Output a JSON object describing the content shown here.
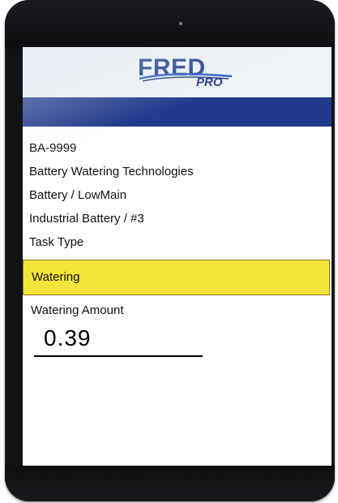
{
  "app": {
    "logo_main": "FRED",
    "logo_sub": "PRO",
    "brand_color": "#223a8c",
    "highlight_color": "#f5e43a"
  },
  "info": {
    "id": "BA-9999",
    "company": "Battery Watering Technologies",
    "battery_type": "Battery / LowMain",
    "unit": "Industrial Battery / #3",
    "task_type_label": "Task Type"
  },
  "task": {
    "selected_value": "Watering"
  },
  "amount": {
    "label": "Watering Amount",
    "value": "0.39"
  },
  "icons": {
    "camera": "front-camera-icon"
  }
}
